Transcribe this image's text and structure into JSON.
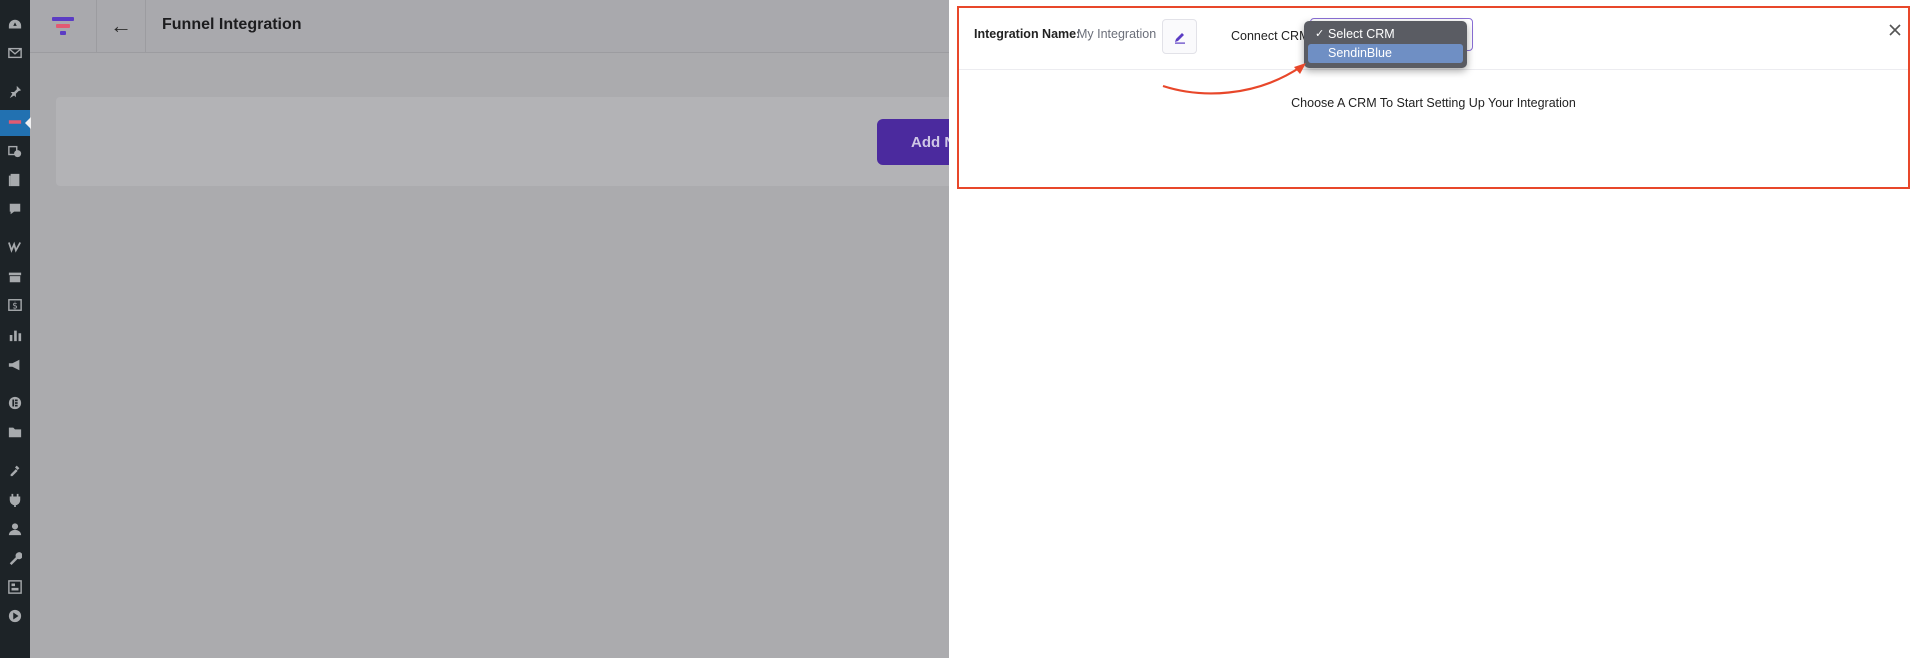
{
  "sidebar": {
    "items": [
      {
        "icon": "dashboard-icon"
      },
      {
        "icon": "mail-icon"
      },
      {
        "icon": "pin-icon"
      },
      {
        "icon": "funnel-plugin-icon"
      },
      {
        "icon": "media-icon"
      },
      {
        "icon": "pages-icon"
      },
      {
        "icon": "comments-icon"
      },
      {
        "icon": "woocommerce-icon"
      },
      {
        "icon": "products-icon"
      },
      {
        "icon": "payments-icon"
      },
      {
        "icon": "analytics-icon"
      },
      {
        "icon": "marketing-icon"
      },
      {
        "icon": "elementor-icon"
      },
      {
        "icon": "templates-icon"
      },
      {
        "icon": "appearance-icon"
      },
      {
        "icon": "plugins-icon"
      },
      {
        "icon": "users-icon"
      },
      {
        "icon": "tools-icon"
      },
      {
        "icon": "settings-icon"
      },
      {
        "icon": "media-player-icon"
      }
    ],
    "active_color": "#2271b1"
  },
  "header": {
    "back_glyph": "←",
    "title": "Funnel Integration"
  },
  "content": {
    "add_button_label": "Add N"
  },
  "drawer": {
    "integration_name_label": "Integration Name:",
    "integration_name_value": "My Integration",
    "connect_crm_label": "Connect CRM",
    "crm_options": [
      {
        "label": "Select CRM",
        "checked": true
      },
      {
        "label": "SendinBlue",
        "checked": false
      }
    ],
    "check_glyph": "✓",
    "hint": "Choose A CRM To Start Setting Up Your Integration",
    "highlight_color": "#e8472a",
    "accent_color": "#4b2a9e"
  }
}
